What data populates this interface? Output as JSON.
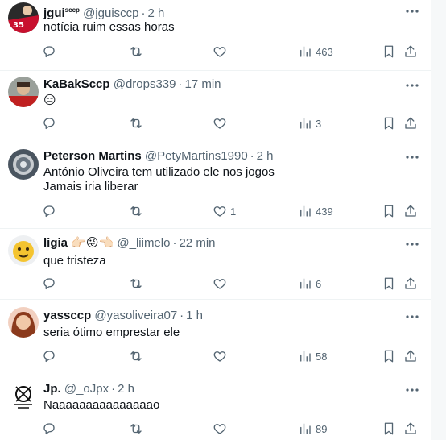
{
  "colors": {
    "text": "#0f1419",
    "muted": "#536471",
    "divider": "#eff3f4"
  },
  "tweets": [
    {
      "name": "jgui",
      "name_sup": "sccp",
      "handle": "@jguisccp",
      "sep": "·",
      "time": "2 h",
      "text": "notícia ruim essas horas",
      "likes": "",
      "views": "463"
    },
    {
      "name": "KaBakSccp",
      "handle": "@drops339",
      "sep": "·",
      "time": "17 min",
      "text": "😑",
      "likes": "",
      "views": "3"
    },
    {
      "name": "Peterson Martins",
      "handle": "@PetyMartins1990",
      "sep": "·",
      "time": "2 h",
      "text": "António Oliveira tem utilizado ele nos jogos\nJamais iria liberar",
      "likes": "1",
      "views": "439"
    },
    {
      "name": "ligia",
      "handle": "@_liimelo",
      "sep": "·",
      "time": "22 min",
      "text": "que tristeza",
      "likes": "",
      "views": "6",
      "name_emojis": [
        "👉🏻",
        "😜",
        "👈🏻"
      ]
    },
    {
      "name": "yassccp",
      "handle": "@yasoliveira07",
      "sep": "·",
      "time": "1 h",
      "text": "seria ótimo emprestar ele",
      "likes": "",
      "views": "58"
    },
    {
      "name": "Jp.",
      "handle": "@_oJpx",
      "sep": "·",
      "time": "2 h",
      "text": "Naaaaaaaaaaaaaaao",
      "likes": "",
      "views": "89"
    }
  ],
  "icons": [
    "reply-icon",
    "retweet-icon",
    "like-icon",
    "views-icon",
    "bookmark-icon",
    "share-icon",
    "more-icon"
  ]
}
